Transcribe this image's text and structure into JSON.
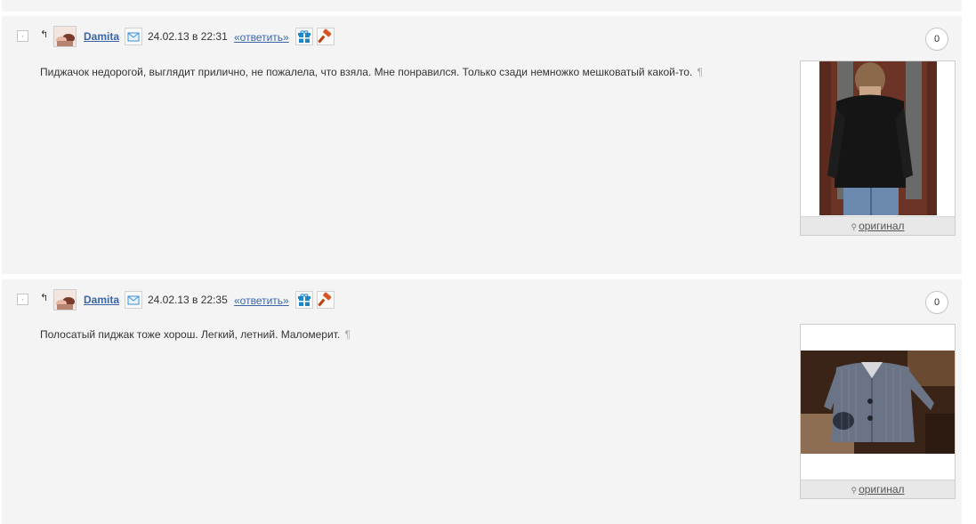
{
  "comments": [
    {
      "collapse_symbol": "·",
      "parent_arrow": "↰",
      "username": "Damita",
      "datetime": "24.02.13 в 22:31",
      "reply_label": "«ответить»",
      "rating": "0",
      "text": "Пиджачок недорогой, выглядит прилично, не пожалела, что взяла. Мне понравился. Только сзади немножко мешковатый какой-то.",
      "pilcrow": "¶",
      "original_label": "оригинал",
      "magnifier": "⚲"
    },
    {
      "collapse_symbol": "·",
      "parent_arrow": "↰",
      "username": "Damita",
      "datetime": "24.02.13 в 22:35",
      "reply_label": "«ответить»",
      "rating": "0",
      "text": "Полосатый пиджак тоже хорош. Легкий, летний. Маломерит.",
      "pilcrow": "¶",
      "original_label": "оригинал",
      "magnifier": "⚲"
    }
  ],
  "icons": {
    "collapse": "collapse-toggle-icon",
    "parent": "parent-comment-arrow-icon",
    "avatar": "user-avatar",
    "mail": "envelope-icon",
    "gift": "gift-icon",
    "ban": "gavel-icon"
  },
  "colors": {
    "link": "#3a66a7",
    "panel_bg": "#f4f4f4",
    "mail_accent": "#3a8fd6",
    "gift_accent": "#1f87c8",
    "gavel_accent": "#d9531e"
  }
}
